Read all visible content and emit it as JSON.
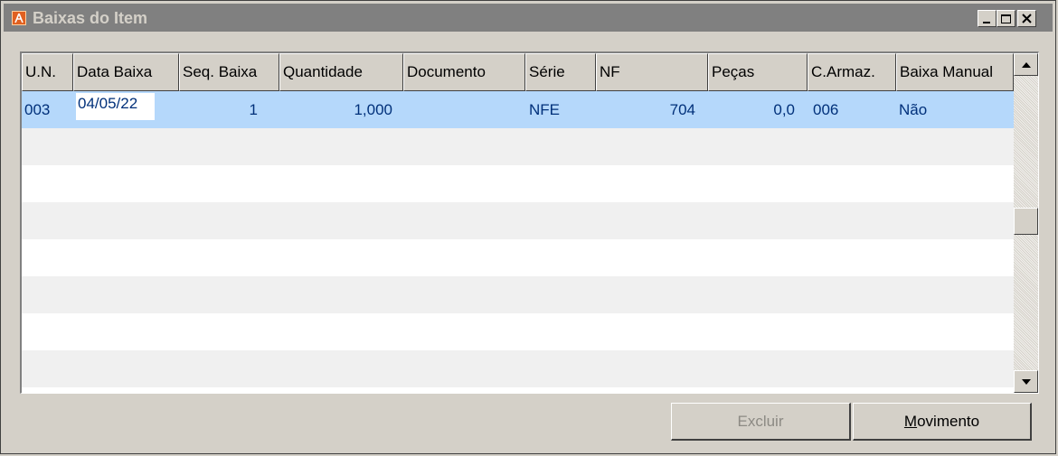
{
  "window": {
    "title": "Baixas do Item",
    "icon": "app-logo-icon"
  },
  "title_buttons": [
    "minimize-icon",
    "maximize-icon",
    "close-icon"
  ],
  "grid": {
    "columns": [
      "U.N.",
      "Data Baixa",
      "Seq. Baixa",
      "Quantidade",
      "Documento",
      "Série",
      "NF",
      "Peças",
      "C.Armaz.",
      "Baixa Manual"
    ],
    "rows": [
      {
        "un": "003",
        "data_baixa": "04/05/22",
        "seq_baixa": "1",
        "quantidade": "1,000",
        "documento": "",
        "serie": "NFE",
        "nf": "704",
        "pecas": "0,0",
        "c_armaz": "006",
        "baixa_manual": "Não"
      }
    ]
  },
  "buttons": {
    "excluir": "Excluir",
    "movimento_accel": "M",
    "movimento_rest": "ovimento"
  },
  "colors": {
    "selected_row": "#b5d8fb",
    "cell_text": "#00307a",
    "title_bar_inactive": "#808080"
  }
}
